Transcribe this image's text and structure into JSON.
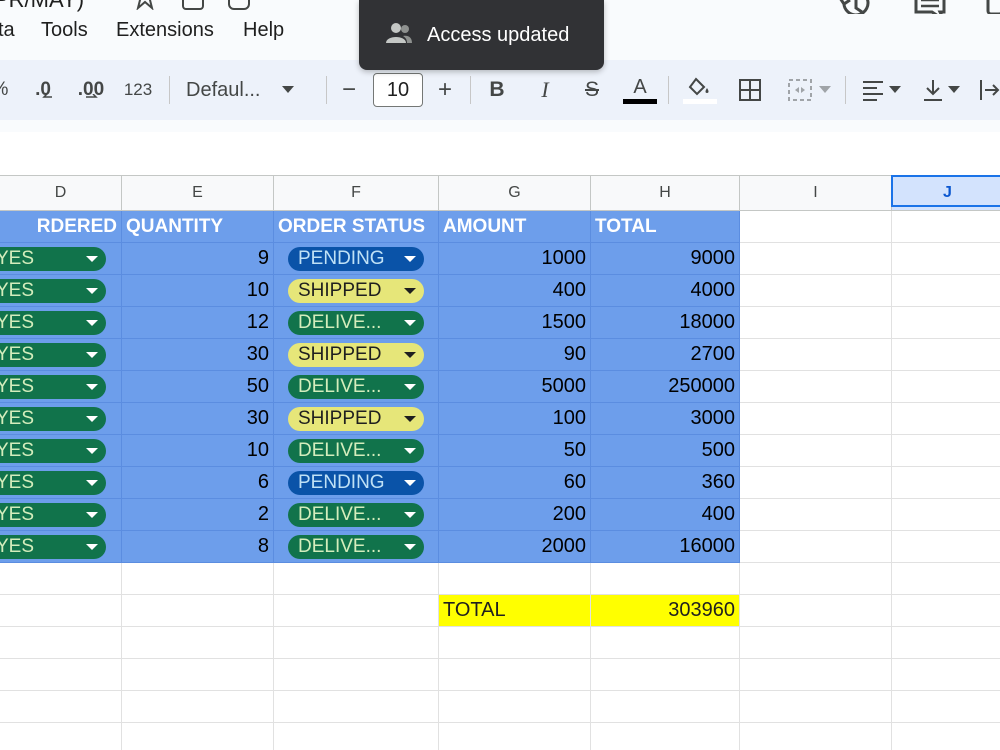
{
  "document": {
    "title_fragment": "PR/MAY)"
  },
  "menu": [
    {
      "label": "ta"
    },
    {
      "label": "Tools"
    },
    {
      "label": "Extensions"
    },
    {
      "label": "Help"
    }
  ],
  "toast": {
    "text": "Access updated",
    "icon": "person-group-icon"
  },
  "toolbar": {
    "percent_fragment": "%",
    "decrease_decimal": ".0",
    "increase_decimal": ".00",
    "number_format": "123",
    "font_name": "Defaul...",
    "font_size": "10",
    "minus": "−",
    "plus": "+",
    "bold": "B",
    "italic": "I",
    "strike": "S",
    "text_color_letter": "A"
  },
  "columns": [
    {
      "letter": "D"
    },
    {
      "letter": "E"
    },
    {
      "letter": "F"
    },
    {
      "letter": "G"
    },
    {
      "letter": "H"
    },
    {
      "letter": "I"
    },
    {
      "letter": "J"
    }
  ],
  "table": {
    "headers": {
      "d": "RDERED",
      "e": "QUANTITY",
      "f": "ORDER STATUS",
      "g": "AMOUNT",
      "h": "TOTAL"
    },
    "rows": [
      {
        "ordered": "YES",
        "quantity": "9",
        "status": "PENDING",
        "status_type": "pending",
        "amount": "1000",
        "total": "9000"
      },
      {
        "ordered": "YES",
        "quantity": "10",
        "status": "SHIPPED",
        "status_type": "shipped",
        "amount": "400",
        "total": "4000"
      },
      {
        "ordered": "YES",
        "quantity": "12",
        "status": "DELIVE...",
        "status_type": "delivered",
        "amount": "1500",
        "total": "18000"
      },
      {
        "ordered": "YES",
        "quantity": "30",
        "status": "SHIPPED",
        "status_type": "shipped",
        "amount": "90",
        "total": "2700"
      },
      {
        "ordered": "YES",
        "quantity": "50",
        "status": "DELIVE...",
        "status_type": "delivered",
        "amount": "5000",
        "total": "250000"
      },
      {
        "ordered": "YES",
        "quantity": "30",
        "status": "SHIPPED",
        "status_type": "shipped",
        "amount": "100",
        "total": "3000"
      },
      {
        "ordered": "YES",
        "quantity": "10",
        "status": "DELIVE...",
        "status_type": "delivered",
        "amount": "50",
        "total": "500"
      },
      {
        "ordered": "YES",
        "quantity": "6",
        "status": "PENDING",
        "status_type": "pending",
        "amount": "60",
        "total": "360"
      },
      {
        "ordered": "YES",
        "quantity": "2",
        "status": "DELIVE...",
        "status_type": "delivered",
        "amount": "200",
        "total": "400"
      },
      {
        "ordered": "YES",
        "quantity": "8",
        "status": "DELIVE...",
        "status_type": "delivered",
        "amount": "2000",
        "total": "16000"
      }
    ],
    "grand_total": {
      "label": "TOTAL",
      "value": "303960"
    }
  },
  "colors": {
    "table_blue": "#6d9eeb",
    "total_yellow": "#ffff00",
    "yes_chip": "#11734b",
    "pending_chip": "#0a53a8",
    "shipped_chip": "#e6e679",
    "selection": "#1a73e8"
  }
}
